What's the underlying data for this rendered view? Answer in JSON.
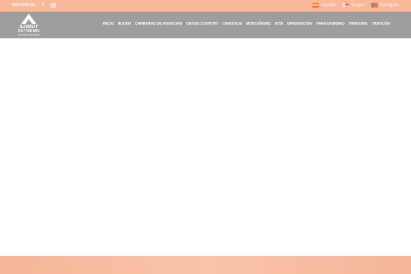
{
  "topbar": {
    "follow_label": "SIGUENOS",
    "social": [
      {
        "icon": "facebook-icon",
        "glyph": "f"
      },
      {
        "icon": "instagram-icon"
      }
    ],
    "languages": [
      {
        "label": "Español",
        "flag": "spain-flag-icon"
      },
      {
        "label": "English",
        "flag": "uk-flag-icon"
      },
      {
        "label": "Português",
        "flag": "portugal-flag-icon"
      }
    ]
  },
  "header": {
    "logo": {
      "line1": "AZIMUT",
      "line2": "EXTREMO",
      "tagline": "DEPORTES AVENTURAS"
    },
    "nav": [
      {
        "label": "INICIO"
      },
      {
        "label": "BUCEO"
      },
      {
        "label": "CARRERAS DE AVENTURA"
      },
      {
        "label": "CROSS COUNTRY"
      },
      {
        "label": "CANOTAJE"
      },
      {
        "label": "MONTAÑISMO"
      },
      {
        "label": "MTB"
      },
      {
        "label": "ORIENTACIÓN"
      },
      {
        "label": "PARACAIDISMO"
      },
      {
        "label": "TREKKING"
      },
      {
        "label": "TRIATLÓN"
      }
    ]
  },
  "colors": {
    "topbar": "#f9b898",
    "header": "#9e9e9e",
    "footer": "#f6b699",
    "text": "#ffffff"
  }
}
